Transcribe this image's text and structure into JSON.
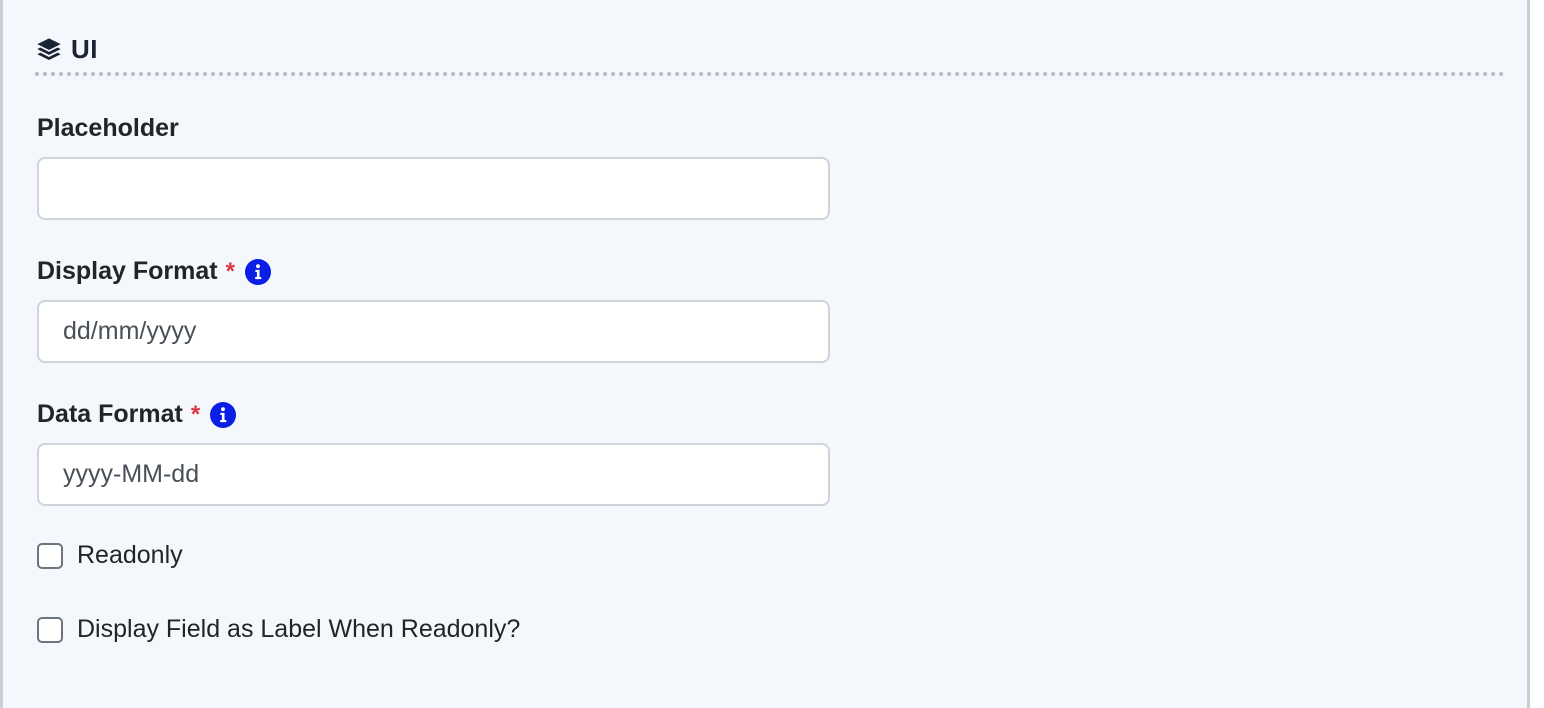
{
  "section": {
    "title": "UI",
    "icon": "layers-icon"
  },
  "fields": {
    "placeholder": {
      "label": "Placeholder",
      "value": ""
    },
    "display_format": {
      "label": "Display Format",
      "required_mark": "*",
      "value": "dd/mm/yyyy"
    },
    "data_format": {
      "label": "Data Format",
      "required_mark": "*",
      "value": "yyyy-MM-dd"
    }
  },
  "checkboxes": {
    "readonly": {
      "label": "Readonly",
      "checked": false
    },
    "display_as_label": {
      "label": "Display Field as Label When Readonly?",
      "checked": false
    }
  },
  "colors": {
    "panel_bg": "#f4f8fd",
    "required": "#dc3545",
    "info_icon": "#0a1ee6"
  }
}
